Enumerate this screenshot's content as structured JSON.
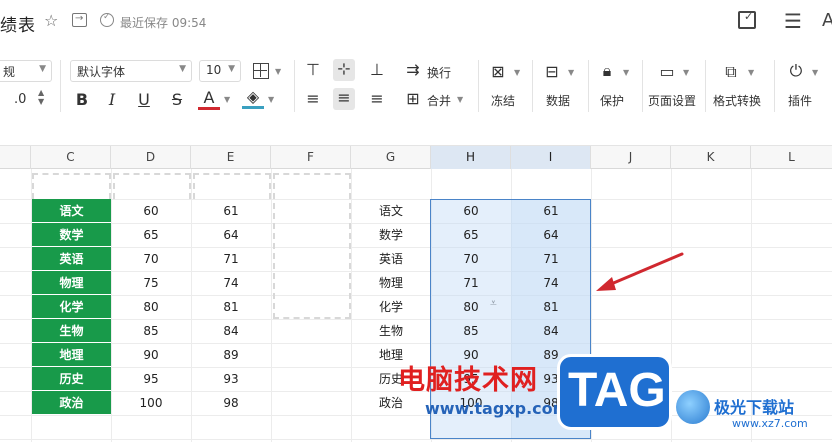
{
  "titlebar": {
    "doc_title": "绩表",
    "saved_status": "最近保存 09:54"
  },
  "toolbar": {
    "number_format": "规",
    "font_name": "默认字体",
    "font_size": "10",
    "decimal_label": ".0",
    "wrap_label": "换行",
    "merge_label": "合并",
    "freeze_label": "冻结",
    "data_label": "数据",
    "protect_label": "保护",
    "page_setup_label": "页面设置",
    "format_convert_label": "格式转换",
    "plugin_label": "插件"
  },
  "columns": [
    "C",
    "D",
    "E",
    "F",
    "G",
    "H",
    "I",
    "J",
    "K",
    "L"
  ],
  "left_table": {
    "subjects": [
      "语文",
      "数学",
      "英语",
      "物理",
      "化学",
      "生物",
      "地理",
      "历史",
      "政治"
    ],
    "col_d": [
      "60",
      "65",
      "70",
      "75",
      "80",
      "85",
      "90",
      "95",
      "100"
    ],
    "col_e": [
      "61",
      "64",
      "71",
      "74",
      "81",
      "84",
      "89",
      "93",
      "98"
    ]
  },
  "right_table": {
    "subjects": [
      "语文",
      "数学",
      "英语",
      "物理",
      "化学",
      "生物",
      "地理",
      "历史",
      "政治"
    ],
    "col_h": [
      "60",
      "65",
      "70",
      "71",
      "80",
      "85",
      "90",
      "95",
      "100"
    ],
    "col_i": [
      "61",
      "64",
      "71",
      "74",
      "81",
      "84",
      "89",
      "93",
      "98"
    ]
  },
  "watermark": {
    "line1": "电脑技术网",
    "line2": "www.tagxp.com",
    "tag": "TAG",
    "site": "极光下载站",
    "site_url": "www.xz7.com"
  },
  "colors": {
    "green_header": "#189a4a",
    "selection": "#4a84c8",
    "arrow": "#d0282f",
    "tag_badge": "#1f6fd1"
  }
}
